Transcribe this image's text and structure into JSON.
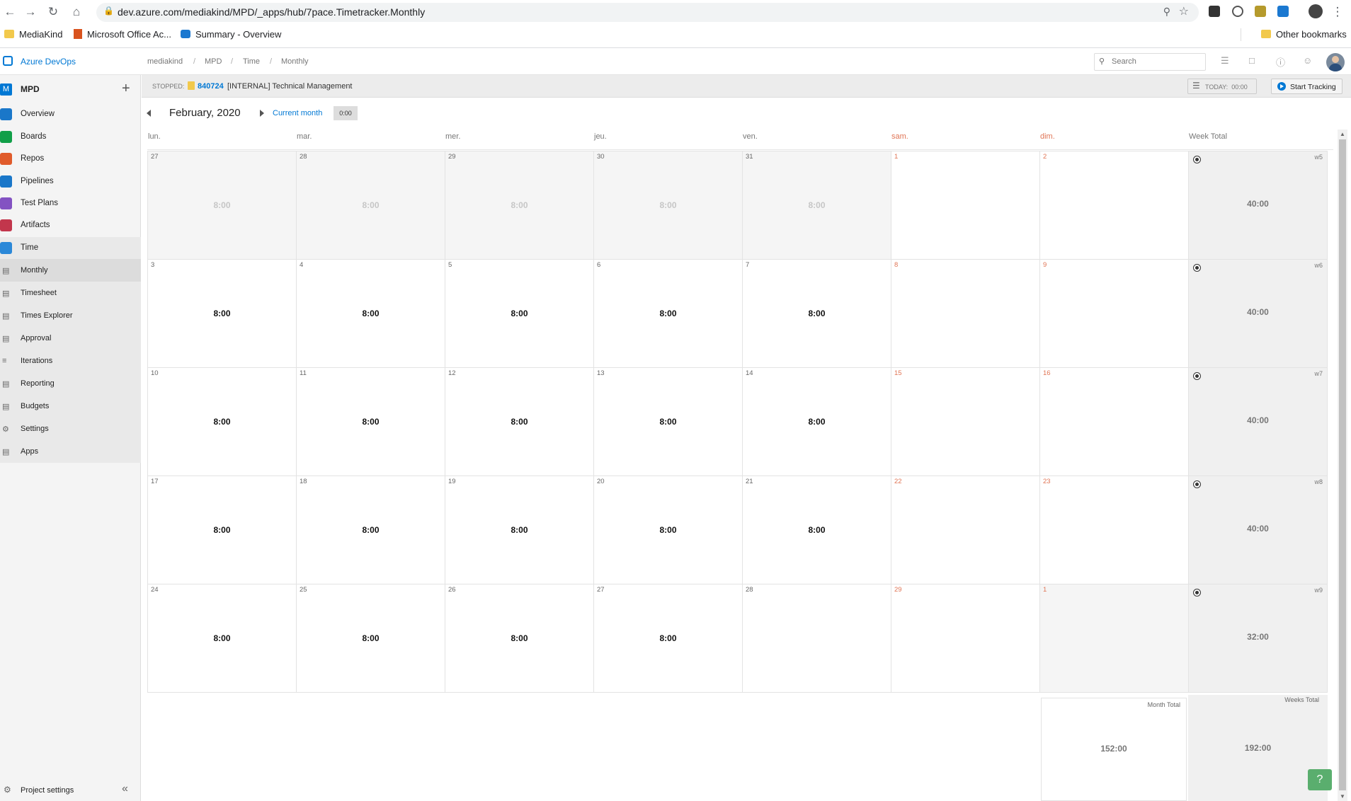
{
  "browser": {
    "url": "dev.azure.com/mediakind/MPD/_apps/hub/7pace.Timetracker.Monthly",
    "bookmarks": [
      "MediaKind",
      "Microsoft Office Ac...",
      "Summary - Overview"
    ],
    "other_bookmarks": "Other bookmarks"
  },
  "header": {
    "app_name": "Azure DevOps",
    "breadcrumb": [
      "mediakind",
      "MPD",
      "Time",
      "Monthly"
    ],
    "search_placeholder": "Search"
  },
  "sidebar": {
    "project_initial": "M",
    "project_name": "MPD",
    "items": [
      {
        "label": "Overview",
        "icon": "overview-icon",
        "color": "#1a77c9"
      },
      {
        "label": "Boards",
        "icon": "boards-icon",
        "color": "#109f48"
      },
      {
        "label": "Repos",
        "icon": "repos-icon",
        "color": "#e05b2b"
      },
      {
        "label": "Pipelines",
        "icon": "pipelines-icon",
        "color": "#1a77c9"
      },
      {
        "label": "Test Plans",
        "icon": "test-plans-icon",
        "color": "#8352c2"
      },
      {
        "label": "Artifacts",
        "icon": "artifacts-icon",
        "color": "#c2364c"
      },
      {
        "label": "Time",
        "icon": "time-icon",
        "color": "#2b88d8"
      }
    ],
    "time_subitems": [
      "Monthly",
      "Timesheet",
      "Times Explorer",
      "Approval",
      "Iterations",
      "Reporting",
      "Budgets",
      "Settings",
      "Apps"
    ],
    "active_subitem": "Monthly",
    "project_settings": "Project settings"
  },
  "tracker": {
    "status": "STOPPED:",
    "work_item_id": "840724",
    "work_item_title": "[INTERNAL] Technical Management",
    "today_label": "TODAY:",
    "today_value": "00:00",
    "start_label": "Start Tracking"
  },
  "month_nav": {
    "title": "February, 2020",
    "current_month": "Current month",
    "total_badge": "0:00"
  },
  "calendar": {
    "day_headers": [
      "lun.",
      "mar.",
      "mer.",
      "jeu.",
      "ven.",
      "sam.",
      "dim."
    ],
    "week_total_header": "Week Total",
    "weeks": [
      {
        "label": "w5",
        "total": "40:00",
        "days": [
          {
            "d": "27",
            "h": "8:00",
            "other": true
          },
          {
            "d": "28",
            "h": "8:00",
            "other": true
          },
          {
            "d": "29",
            "h": "8:00",
            "other": true
          },
          {
            "d": "30",
            "h": "8:00",
            "other": true
          },
          {
            "d": "31",
            "h": "8:00",
            "other": true
          },
          {
            "d": "1",
            "h": ""
          },
          {
            "d": "2",
            "h": ""
          }
        ]
      },
      {
        "label": "w6",
        "total": "40:00",
        "days": [
          {
            "d": "3",
            "h": "8:00"
          },
          {
            "d": "4",
            "h": "8:00"
          },
          {
            "d": "5",
            "h": "8:00"
          },
          {
            "d": "6",
            "h": "8:00"
          },
          {
            "d": "7",
            "h": "8:00"
          },
          {
            "d": "8",
            "h": ""
          },
          {
            "d": "9",
            "h": ""
          }
        ]
      },
      {
        "label": "w7",
        "total": "40:00",
        "days": [
          {
            "d": "10",
            "h": "8:00"
          },
          {
            "d": "11",
            "h": "8:00"
          },
          {
            "d": "12",
            "h": "8:00"
          },
          {
            "d": "13",
            "h": "8:00"
          },
          {
            "d": "14",
            "h": "8:00"
          },
          {
            "d": "15",
            "h": ""
          },
          {
            "d": "16",
            "h": ""
          }
        ]
      },
      {
        "label": "w8",
        "total": "40:00",
        "days": [
          {
            "d": "17",
            "h": "8:00"
          },
          {
            "d": "18",
            "h": "8:00"
          },
          {
            "d": "19",
            "h": "8:00"
          },
          {
            "d": "20",
            "h": "8:00"
          },
          {
            "d": "21",
            "h": "8:00"
          },
          {
            "d": "22",
            "h": ""
          },
          {
            "d": "23",
            "h": ""
          }
        ]
      },
      {
        "label": "w9",
        "total": "32:00",
        "days": [
          {
            "d": "24",
            "h": "8:00"
          },
          {
            "d": "25",
            "h": "8:00"
          },
          {
            "d": "26",
            "h": "8:00"
          },
          {
            "d": "27",
            "h": "8:00"
          },
          {
            "d": "28",
            "h": ""
          },
          {
            "d": "29",
            "h": ""
          },
          {
            "d": "1",
            "h": "",
            "other": true
          }
        ]
      }
    ],
    "month_total_label": "Month Total",
    "month_total": "152:00",
    "weeks_total_label": "Weeks Total",
    "weeks_total": "192:00"
  },
  "colors": {
    "accent": "#0078d4",
    "weekend": "#e07555",
    "help_button": "#5aae6e"
  }
}
